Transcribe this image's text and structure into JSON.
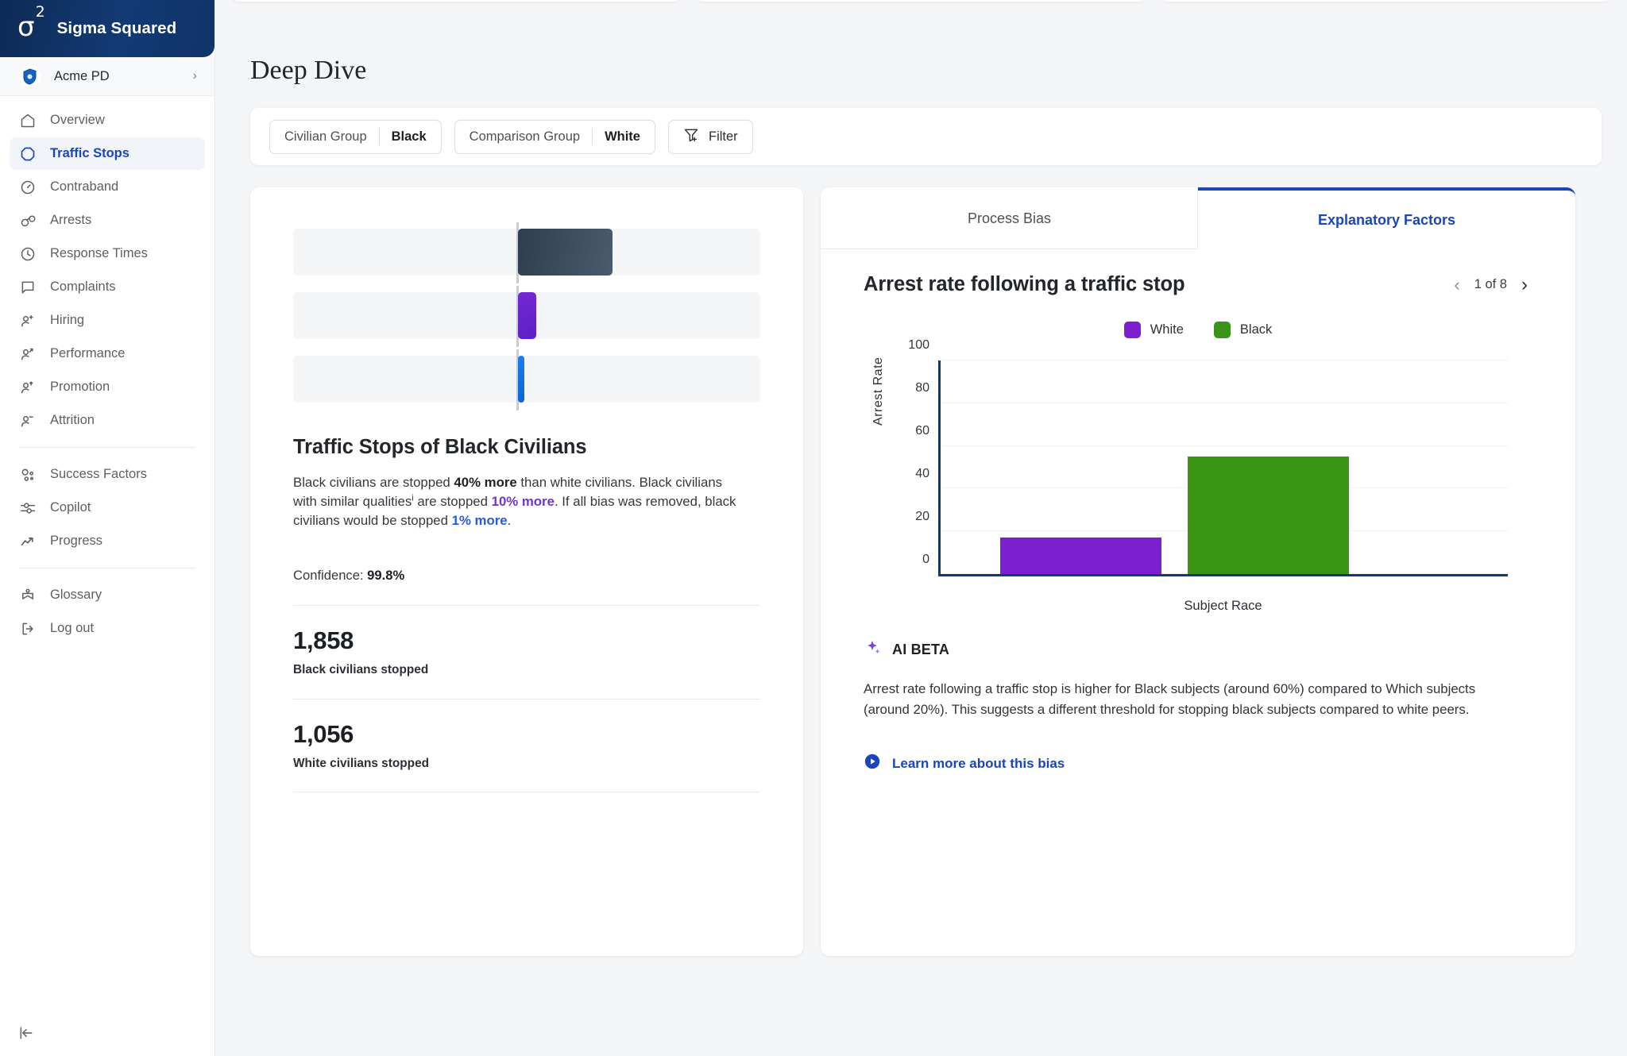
{
  "brand": {
    "logo": "σ",
    "logo_sup": "2",
    "name": "Sigma Squared"
  },
  "org": {
    "name": "Acme PD",
    "chevron": "›"
  },
  "sidebar": {
    "items": [
      {
        "label": "Overview",
        "icon": "home-icon"
      },
      {
        "label": "Traffic Stops",
        "icon": "octagon-icon"
      },
      {
        "label": "Contraband",
        "icon": "gauge-icon"
      },
      {
        "label": "Arrests",
        "icon": "handcuffs-icon"
      },
      {
        "label": "Response Times",
        "icon": "clock-icon"
      },
      {
        "label": "Complaints",
        "icon": "message-icon"
      },
      {
        "label": "Hiring",
        "icon": "user-plus-icon"
      },
      {
        "label": "Performance",
        "icon": "user-arrow-icon"
      },
      {
        "label": "Promotion",
        "icon": "user-up-icon"
      },
      {
        "label": "Attrition",
        "icon": "user-minus-icon"
      }
    ],
    "group2": [
      {
        "label": "Success Factors",
        "icon": "nodes-icon"
      },
      {
        "label": "Copilot",
        "icon": "sliders-icon"
      },
      {
        "label": "Progress",
        "icon": "trend-up-icon"
      }
    ],
    "group3": [
      {
        "label": "Glossary",
        "icon": "book-icon"
      },
      {
        "label": "Log out",
        "icon": "logout-icon"
      }
    ],
    "active_label": "Traffic Stops",
    "collapse_icon": "collapse-left-icon"
  },
  "header": {
    "title": "Deep Dive"
  },
  "filters": {
    "civilian_group": {
      "label": "Civilian Group",
      "value": "Black"
    },
    "comparison_group": {
      "label": "Comparison Group",
      "value": "White"
    },
    "filter_button": {
      "label": "Filter",
      "icon": "filter-plus-icon"
    }
  },
  "left_card": {
    "title": "Traffic Stops of Black Civilians",
    "body": {
      "s1": "Black civilians are stopped ",
      "b1": "40% more",
      "s2": " than white civilians. Black civilians with similar qualities",
      "sup": "i",
      "s3": " are stopped ",
      "b2": "10% more",
      "s4": ". If all bias was removed, black civilians would be stopped ",
      "b3": "1% more",
      "s5": "."
    },
    "confidence_label": "Confidence: ",
    "confidence_value": "99.8%",
    "stats": [
      {
        "value": "1,858",
        "label": "Black civilians stopped"
      },
      {
        "value": "1,056",
        "label": "White civilians stopped"
      }
    ]
  },
  "right_card": {
    "tabs": [
      {
        "label": "Process Bias",
        "active": false
      },
      {
        "label": "Explanatory Factors",
        "active": true
      }
    ],
    "title": "Arrest rate following a traffic stop",
    "pager": {
      "prev_icon": "chevron-left-icon",
      "count": "1 of 8",
      "next_icon": "chevron-right-icon"
    },
    "ai": {
      "badge": "AI BETA",
      "icon": "sparkle-icon",
      "text": "Arrest rate following a traffic stop is higher for Black subjects (around 60%) compared to Which subjects (around 20%). This suggests a different threshold for stopping black subjects compared to white peers."
    },
    "learn_more": {
      "label": "Learn more about this bias",
      "icon": "play-circle-icon"
    }
  },
  "chart_data": {
    "type": "bar",
    "title": "Arrest rate following a traffic stop",
    "categories": [
      "White",
      "Black"
    ],
    "values": [
      17,
      55
    ],
    "colors": [
      "#7b1fd1",
      "#3a9416"
    ],
    "xlabel": "Subject Race",
    "ylabel": "Arrest Rate",
    "ylim": [
      0,
      100
    ],
    "yticks": [
      0,
      20,
      40,
      60,
      80,
      100
    ],
    "grid": true,
    "legend": [
      {
        "name": "White",
        "color": "#7b1fd1"
      },
      {
        "name": "Black",
        "color": "#3a9416"
      }
    ],
    "legend_position": "top"
  },
  "mini_chart": {
    "type": "bar",
    "orientation": "horizontal",
    "series": [
      {
        "name": "observed-gap",
        "value": 40,
        "color": "#3b4a5c"
      },
      {
        "name": "similar-qualities-gap",
        "value": 10,
        "color": "#6b24cd"
      },
      {
        "name": "residual-bias-gap",
        "value": 1,
        "color": "#1370e3"
      }
    ]
  },
  "accent": {
    "brand_blue": "#1a45bd",
    "purple": "#7b1fd1",
    "green": "#3a9416"
  }
}
